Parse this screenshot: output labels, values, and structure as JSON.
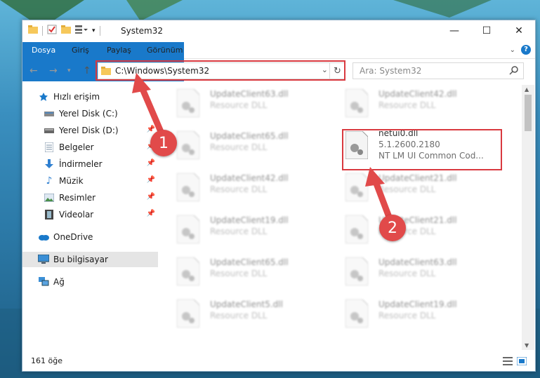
{
  "window": {
    "title": "System32"
  },
  "ribbon": {
    "tabs": [
      "Dosya",
      "Giriş",
      "Paylaş",
      "Görünüm"
    ]
  },
  "address": {
    "path": "C:\\Windows\\System32"
  },
  "search": {
    "placeholder": "Ara: System32"
  },
  "sidebar": {
    "items": [
      {
        "label": "Hızlı erişim",
        "icon": "star-icon"
      },
      {
        "label": "Yerel Disk (C:)",
        "icon": "drive-icon"
      },
      {
        "label": "Yerel Disk (D:)",
        "icon": "drive-icon"
      },
      {
        "label": "Belgeler",
        "icon": "documents-icon"
      },
      {
        "label": "İndirmeler",
        "icon": "download-icon"
      },
      {
        "label": "Müzik",
        "icon": "music-icon"
      },
      {
        "label": "Resimler",
        "icon": "pictures-icon"
      },
      {
        "label": "Videolar",
        "icon": "videos-icon"
      },
      {
        "label": "OneDrive",
        "icon": "cloud-icon"
      },
      {
        "label": "Bu bilgisayar",
        "icon": "computer-icon"
      },
      {
        "label": "Ağ",
        "icon": "network-icon"
      }
    ]
  },
  "files": [
    {
      "name": "UpdateClient63.dll",
      "desc": "Resource DLL"
    },
    {
      "name": "UpdateClient42.dll",
      "desc": "Resource DLL"
    },
    {
      "name": "UpdateClient65.dll",
      "desc": "Resource DLL"
    },
    {
      "name": "netui0.dll",
      "version": "5.1.2600.2180",
      "desc": "NT LM UI Common Cod..."
    },
    {
      "name": "UpdateClient42.dll",
      "desc": "Resource DLL"
    },
    {
      "name": "UpdateClient21.dll",
      "desc": "Resource DLL"
    },
    {
      "name": "UpdateClient19.dll",
      "desc": "Resource DLL"
    },
    {
      "name": "UpdateClient21.dll",
      "desc": "Resource DLL"
    },
    {
      "name": "UpdateClient65.dll",
      "desc": "Resource DLL"
    },
    {
      "name": "UpdateClient63.dll",
      "desc": "Resource DLL"
    },
    {
      "name": "UpdateClient5.dll",
      "desc": "Resource DLL"
    },
    {
      "name": "UpdateClient19.dll",
      "desc": "Resource DLL"
    }
  ],
  "status": {
    "count": "161 öğe"
  },
  "annotations": {
    "badge1": "1",
    "badge2": "2"
  },
  "colors": {
    "accent": "#1979ca",
    "annotation": "#d9393f"
  }
}
